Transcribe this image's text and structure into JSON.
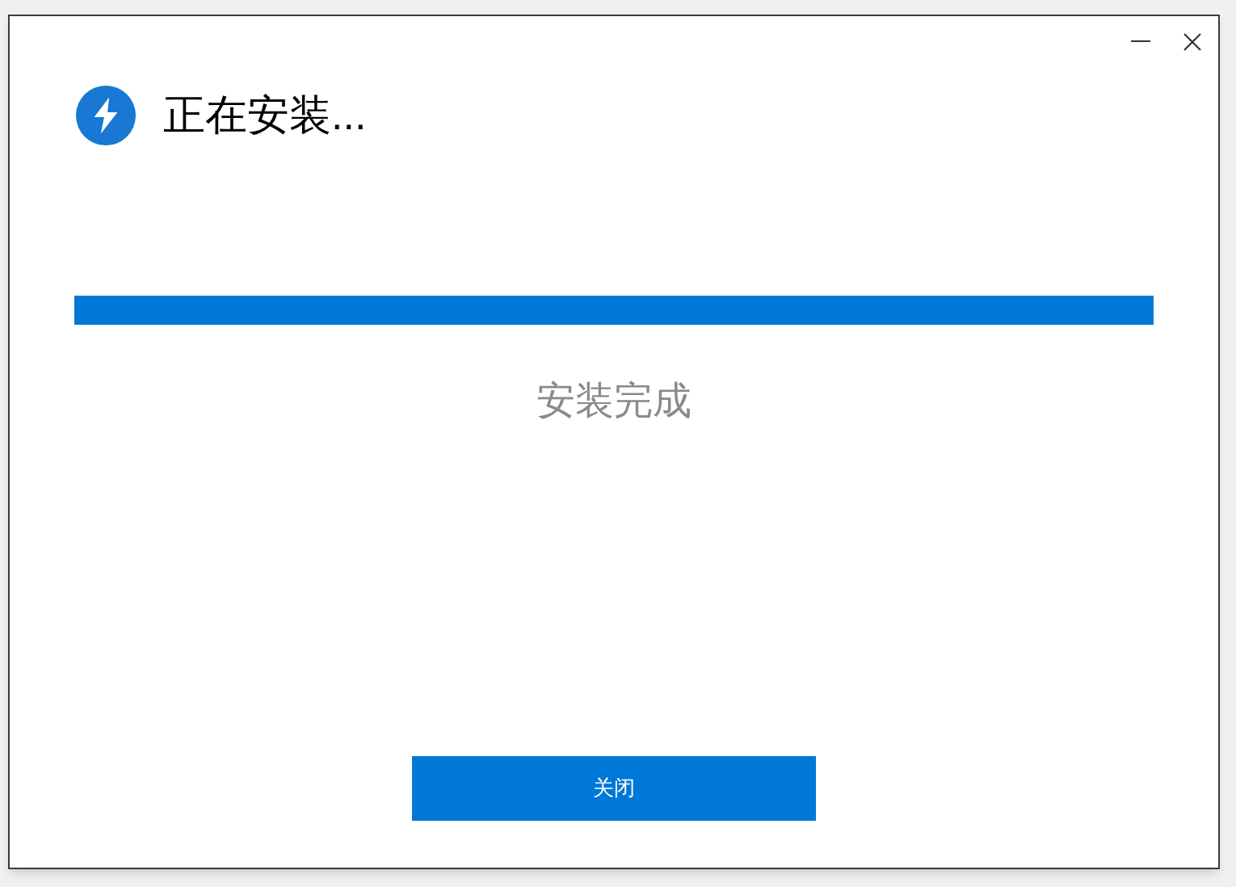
{
  "window": {
    "title": "正在安装..."
  },
  "status": "安装完成",
  "buttons": [
    {
      "label": "关闭"
    }
  ]
}
